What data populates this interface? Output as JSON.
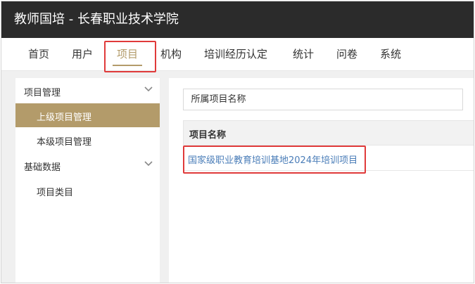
{
  "app": {
    "title": "教师国培 - 长春职业技术学院"
  },
  "nav": {
    "items": [
      {
        "label": "首页"
      },
      {
        "label": "用户"
      },
      {
        "label": "项目"
      },
      {
        "label": "机构"
      },
      {
        "label": "培训经历认定"
      },
      {
        "label": "统计"
      },
      {
        "label": "问卷"
      },
      {
        "label": "系统"
      }
    ],
    "active": "项目"
  },
  "sidebar": {
    "groups": [
      {
        "label": "项目管理",
        "icon": "chevron-down-icon",
        "items": [
          {
            "label": "上级项目管理",
            "active": true
          },
          {
            "label": "本级项目管理",
            "active": false
          }
        ]
      },
      {
        "label": "基础数据",
        "icon": "chevron-down-icon",
        "items": [
          {
            "label": "项目类目",
            "active": false
          }
        ]
      }
    ]
  },
  "filter": {
    "label": "所属项目名称",
    "value": ""
  },
  "table": {
    "columns": [
      "项目名称"
    ],
    "rows": [
      {
        "name": "国家级职业教育培训基地2024年培训项目"
      }
    ]
  },
  "colors": {
    "titlebar": "#2b2b2b",
    "accent": "#b39b6a",
    "link": "#4a7db8",
    "highlight": "#e03a3a"
  }
}
